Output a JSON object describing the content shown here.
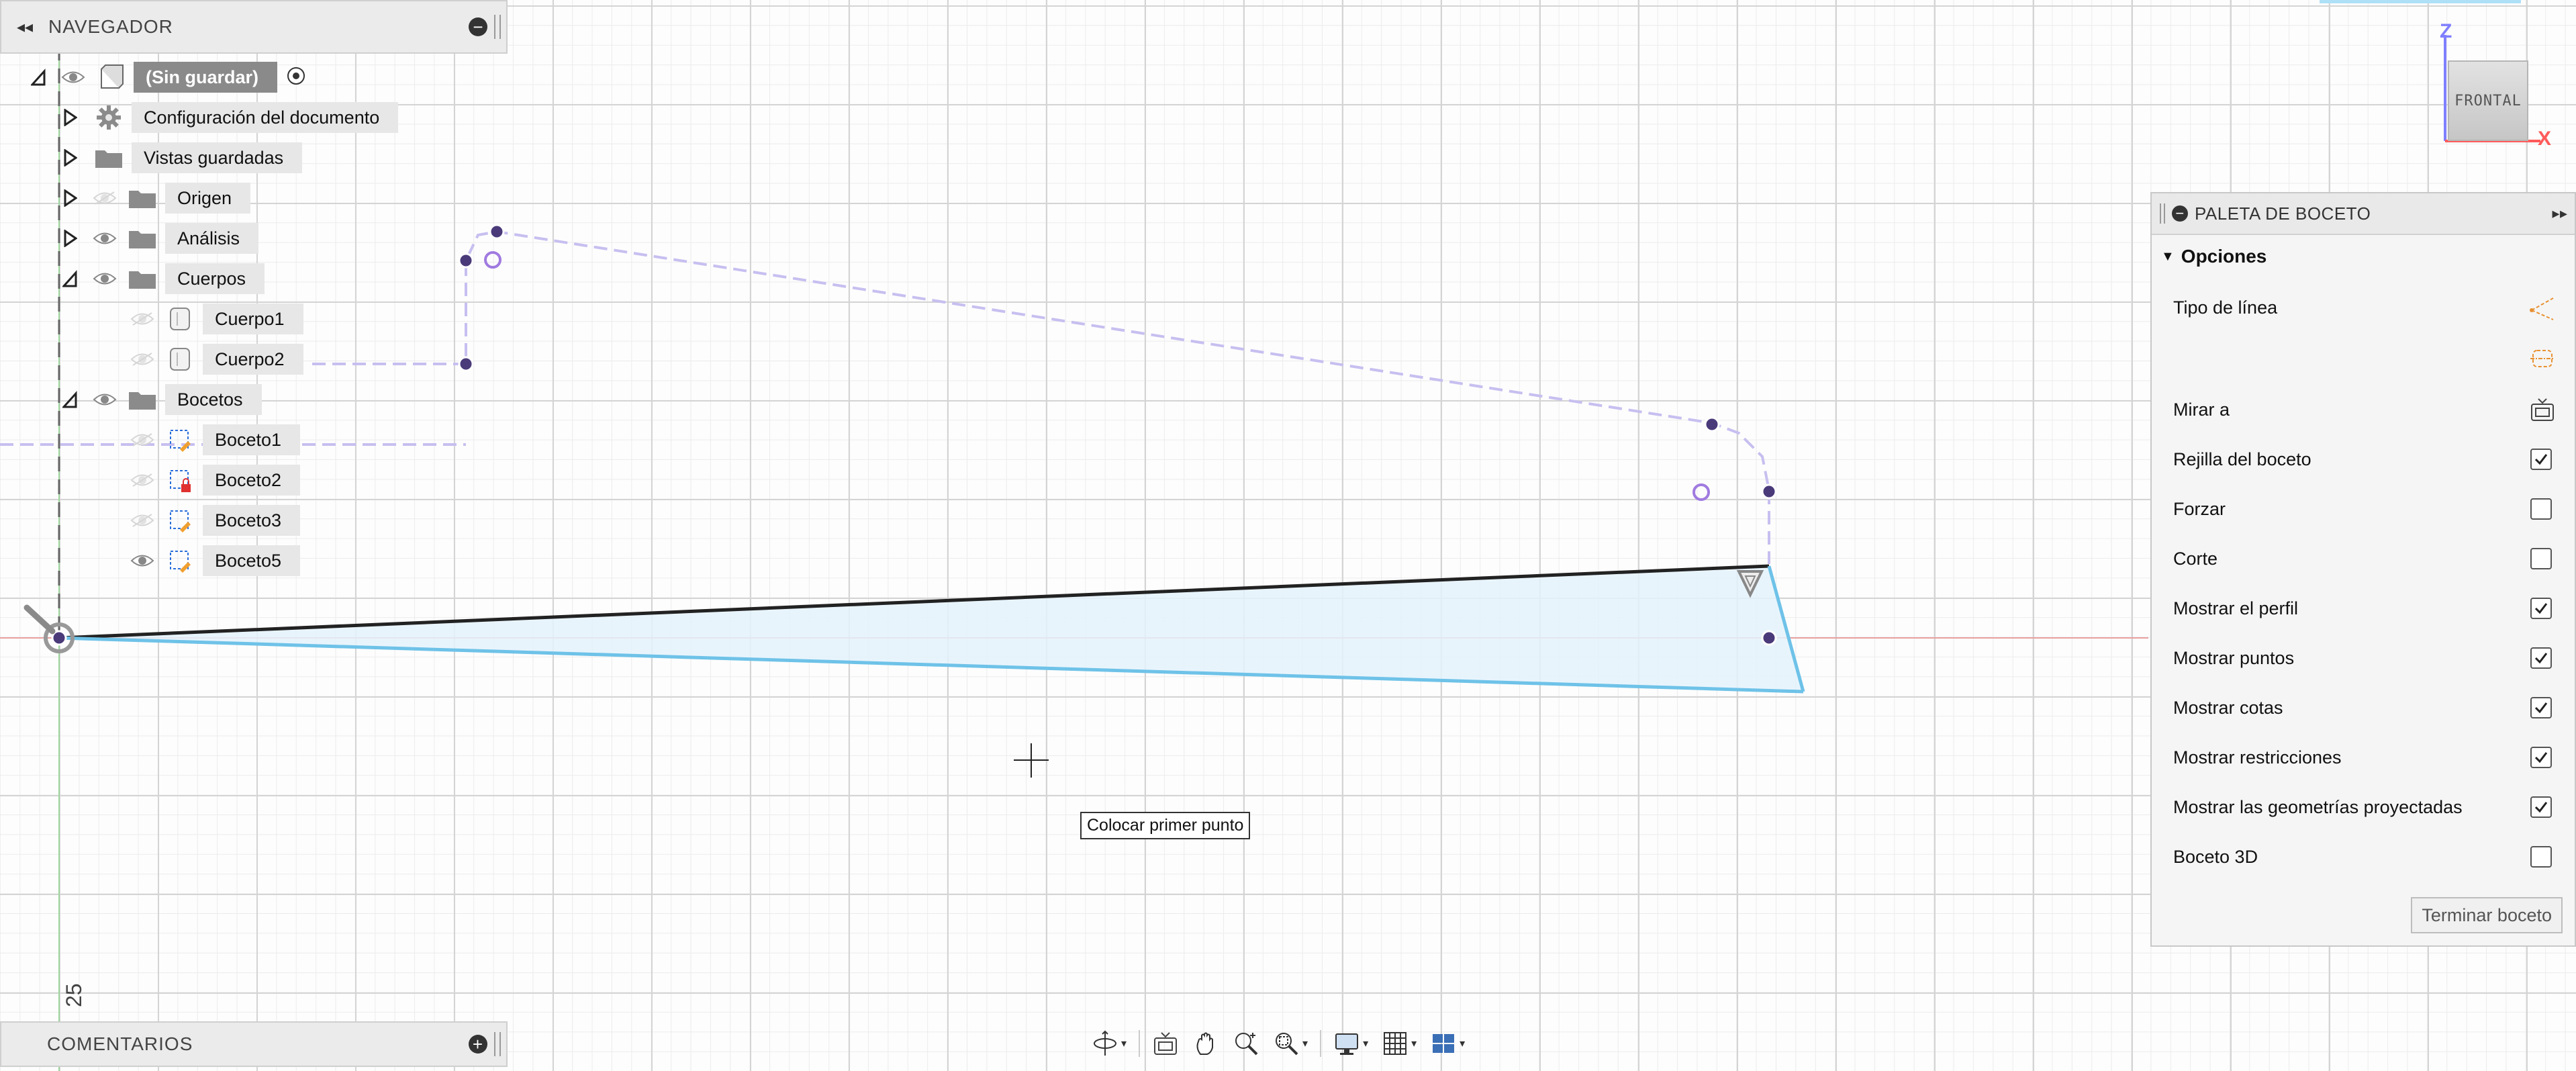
{
  "navigator": {
    "title": "NAVEGADOR",
    "items": [
      {
        "label": "(Sin guardar)",
        "expanded": true,
        "icon": "component-icon"
      },
      {
        "label": "Configuración del documento",
        "expanded": false,
        "icon": "gear-icon"
      },
      {
        "label": "Vistas guardadas",
        "expanded": false,
        "icon": "folder-icon"
      },
      {
        "label": "Origen",
        "expanded": false,
        "icon": "folder-icon",
        "visible": false
      },
      {
        "label": "Análisis",
        "expanded": false,
        "icon": "folder-icon",
        "visible": true
      },
      {
        "label": "Cuerpos",
        "expanded": true,
        "icon": "folder-icon",
        "visible": true
      },
      {
        "label": "Cuerpo1",
        "icon": "body-icon",
        "visible": false
      },
      {
        "label": "Cuerpo2",
        "icon": "body-icon",
        "visible": false
      },
      {
        "label": "Bocetos",
        "expanded": true,
        "icon": "folder-icon",
        "visible": true
      },
      {
        "label": "Boceto1",
        "icon": "sketch-icon",
        "visible": false
      },
      {
        "label": "Boceto2",
        "icon": "sketch-locked-icon",
        "visible": false
      },
      {
        "label": "Boceto3",
        "icon": "sketch-icon",
        "visible": false
      },
      {
        "label": "Boceto5",
        "icon": "sketch-icon",
        "visible": true
      }
    ]
  },
  "comments": {
    "title": "COMENTARIOS"
  },
  "palette": {
    "title": "PALETA DE BOCETO",
    "section": "Opciones",
    "options": [
      {
        "label": "Tipo de línea",
        "type": "icon",
        "icon": "construction-line-icon"
      },
      {
        "label": "",
        "type": "icon",
        "icon": "centerline-icon"
      },
      {
        "label": "Mirar a",
        "type": "icon",
        "icon": "look-at-icon"
      },
      {
        "label": "Rejilla del boceto",
        "type": "checkbox",
        "checked": true
      },
      {
        "label": "Forzar",
        "type": "checkbox",
        "checked": false
      },
      {
        "label": "Corte",
        "type": "checkbox",
        "checked": false
      },
      {
        "label": "Mostrar el perfil",
        "type": "checkbox",
        "checked": true
      },
      {
        "label": "Mostrar puntos",
        "type": "checkbox",
        "checked": true
      },
      {
        "label": "Mostrar cotas",
        "type": "checkbox",
        "checked": true
      },
      {
        "label": "Mostrar restricciones",
        "type": "checkbox",
        "checked": true
      },
      {
        "label": "Mostrar las geometrías proyectadas",
        "type": "checkbox",
        "checked": true
      },
      {
        "label": "Boceto 3D",
        "type": "checkbox",
        "checked": false
      }
    ],
    "finish_button": "Terminar boceto"
  },
  "canvas": {
    "tooltip": "Colocar primer punto",
    "ruler_label": "25"
  },
  "viewcube": {
    "face": "FRONTAL",
    "axis_z": "Z",
    "axis_x": "X"
  },
  "toolbar": {
    "tools": [
      "orbit-icon",
      "look-at-icon",
      "pan-icon",
      "zoom-icon",
      "fit-icon",
      "display-settings-icon",
      "grid-icon",
      "viewports-icon"
    ]
  },
  "colors": {
    "profile_fill": "#e4f2fb",
    "profile_edge": "#6ec2e8",
    "dashed_geometry": "#c7bff0",
    "sketch_point": "#4a3a7a",
    "x_axis": "#e8a0a0",
    "y_axis": "#9fd69f"
  }
}
